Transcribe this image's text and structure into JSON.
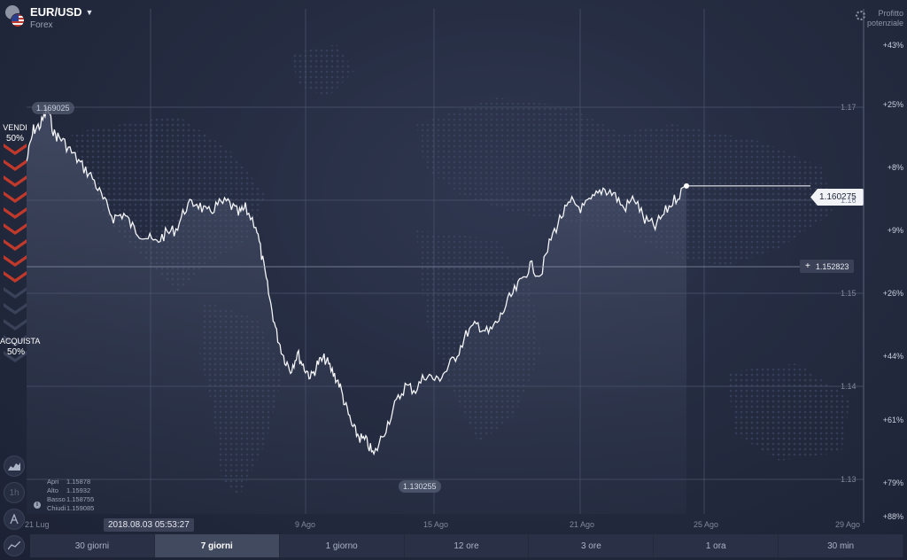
{
  "asset": {
    "name": "EUR/USD",
    "type": "Forex"
  },
  "profit_header": {
    "line1": "Profitto",
    "line2": "potenziale"
  },
  "sentiment": {
    "sell_label": "VENDI",
    "sell_pct": "50%",
    "buy_label": "ACQUISTA",
    "buy_pct": "50%",
    "sell_color": "#c0392b",
    "buy_color": "#3a4259"
  },
  "price_tags": {
    "high": "1.169025",
    "current": "1.160275",
    "strike": "1.152823",
    "low": "1.130255"
  },
  "y_axis_labels": [
    "1.17",
    "1.16",
    "1.15",
    "1.14",
    "1.13"
  ],
  "profit_levels": [
    "+43%",
    "+25%",
    "+8%",
    "+9%",
    "+26%",
    "+44%",
    "+61%",
    "+79%",
    "+88%"
  ],
  "x_axis_labels": [
    "21 Lug",
    "9 Ago",
    "15 Ago",
    "21 Ago",
    "25 Ago",
    "29 Ago"
  ],
  "ohlc": [
    {
      "label": "Apri",
      "value": "1.15878"
    },
    {
      "label": "Alto",
      "value": "1.15932"
    },
    {
      "label": "Basso",
      "value": "1.158755"
    },
    {
      "label": "Chiudi",
      "value": "1.159085"
    }
  ],
  "timestamp": "2018.08.03 05:53:27",
  "tools": {
    "chart_type": "area-chart-icon",
    "interval": "1h",
    "draw": "drawing-tool-icon",
    "indicators": "indicators-icon"
  },
  "timeframes": [
    {
      "label": "30 giorni",
      "active": false
    },
    {
      "label": "7 giorni",
      "active": true
    },
    {
      "label": "1 giorno",
      "active": false
    },
    {
      "label": "12 ore",
      "active": false
    },
    {
      "label": "3 ore",
      "active": false
    },
    {
      "label": "1 ora",
      "active": false
    },
    {
      "label": "30 min",
      "active": false
    }
  ],
  "chart_data": {
    "type": "area",
    "series": [
      {
        "name": "EUR/USD",
        "points": [
          [
            0.0,
            1.163
          ],
          [
            0.02,
            1.1665
          ],
          [
            0.04,
            1.167
          ],
          [
            0.06,
            1.1688
          ],
          [
            0.08,
            1.166
          ],
          [
            0.1,
            1.1655
          ],
          [
            0.13,
            1.164
          ],
          [
            0.16,
            1.1625
          ],
          [
            0.19,
            1.1612
          ],
          [
            0.22,
            1.1588
          ],
          [
            0.25,
            1.1568
          ],
          [
            0.28,
            1.1572
          ],
          [
            0.31,
            1.1555
          ],
          [
            0.34,
            1.1548
          ],
          [
            0.37,
            1.154
          ],
          [
            0.4,
            1.155
          ],
          [
            0.43,
            1.1555
          ],
          [
            0.46,
            1.158
          ],
          [
            0.49,
            1.1585
          ],
          [
            0.52,
            1.1572
          ],
          [
            0.55,
            1.1582
          ],
          [
            0.58,
            1.1585
          ],
          [
            0.61,
            1.1572
          ],
          [
            0.63,
            1.1578
          ],
          [
            0.66,
            1.156
          ],
          [
            0.68,
            1.152
          ],
          [
            0.7,
            1.1478
          ],
          [
            0.72,
            1.144
          ],
          [
            0.74,
            1.1415
          ],
          [
            0.76,
            1.14
          ],
          [
            0.78,
            1.1418
          ],
          [
            0.8,
            1.1402
          ],
          [
            0.82,
            1.1392
          ],
          [
            0.84,
            1.1408
          ],
          [
            0.86,
            1.1412
          ],
          [
            0.88,
            1.1398
          ],
          [
            0.9,
            1.1385
          ],
          [
            0.92,
            1.1358
          ],
          [
            0.94,
            1.1335
          ],
          [
            0.96,
            1.1325
          ],
          [
            0.98,
            1.132
          ],
          [
            1.0,
            1.1305
          ]
        ],
        "points2": [
          [
            1.0,
            1.1305
          ],
          [
            1.03,
            1.1332
          ],
          [
            1.06,
            1.136
          ],
          [
            1.09,
            1.1382
          ],
          [
            1.12,
            1.1378
          ],
          [
            1.15,
            1.1395
          ],
          [
            1.18,
            1.1388
          ],
          [
            1.21,
            1.14
          ],
          [
            1.24,
            1.1418
          ],
          [
            1.27,
            1.1442
          ],
          [
            1.3,
            1.145
          ],
          [
            1.33,
            1.144
          ],
          [
            1.36,
            1.1455
          ],
          [
            1.39,
            1.1478
          ],
          [
            1.42,
            1.1495
          ],
          [
            1.45,
            1.1515
          ],
          [
            1.48,
            1.1505
          ],
          [
            1.51,
            1.1545
          ],
          [
            1.54,
            1.157
          ],
          [
            1.57,
            1.1585
          ],
          [
            1.6,
            1.1578
          ],
          [
            1.63,
            1.1588
          ],
          [
            1.66,
            1.16
          ],
          [
            1.69,
            1.1595
          ],
          [
            1.72,
            1.1578
          ],
          [
            1.75,
            1.159
          ],
          [
            1.78,
            1.1565
          ],
          [
            1.81,
            1.1558
          ],
          [
            1.84,
            1.1575
          ],
          [
            1.87,
            1.159
          ],
          [
            1.9,
            1.1603
          ]
        ]
      }
    ],
    "x_range_labels": [
      "21 Lug",
      "29 Ago"
    ],
    "ylim": [
      1.128,
      1.173
    ],
    "grid": true
  }
}
